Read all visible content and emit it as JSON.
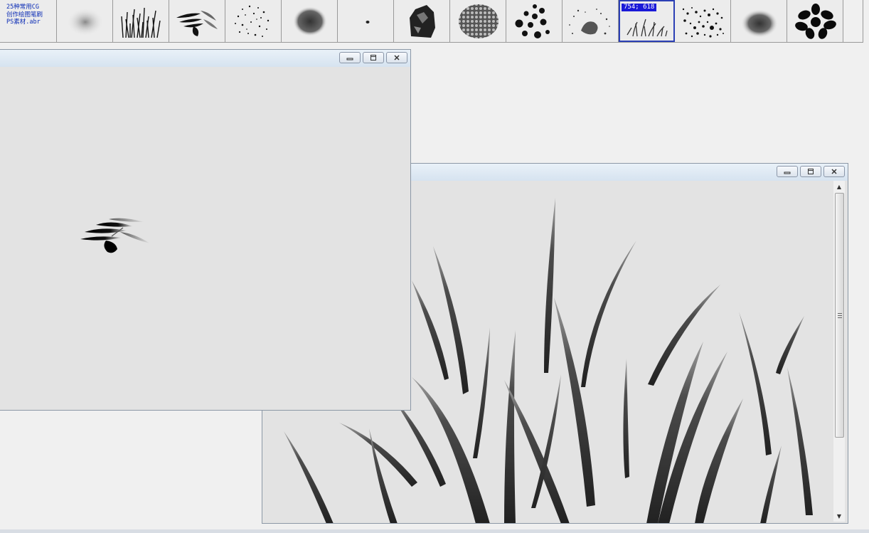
{
  "file_label": [
    "25种常用CG",
    "创作绘图笔刷",
    "PS素材.abr"
  ],
  "brushes": [
    {
      "name": "soft-cloud"
    },
    {
      "name": "grass"
    },
    {
      "name": "leaf-sprig"
    },
    {
      "name": "scatter-dots"
    },
    {
      "name": "sponge"
    },
    {
      "name": "small-dot"
    },
    {
      "name": "rough-rock"
    },
    {
      "name": "texture-pattern"
    },
    {
      "name": "big-dots"
    },
    {
      "name": "splatter"
    },
    {
      "name": "grass-blades",
      "size_badge": "754; 618",
      "selected": true
    },
    {
      "name": "speckle"
    },
    {
      "name": "dark-cloud"
    },
    {
      "name": "ivy-leaves"
    }
  ],
  "window_buttons": {
    "minimize": "minimize",
    "maximize": "maximize",
    "close": "close"
  }
}
